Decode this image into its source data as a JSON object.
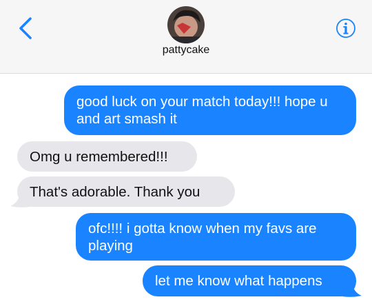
{
  "contact": {
    "name": "pattycake",
    "back_icon": "chevron-left-icon",
    "info_icon": "info-icon",
    "avatar_icon": "profile-photo"
  },
  "colors": {
    "sent_bubble": "#1a83ff",
    "received_bubble": "#e6e6eb",
    "accent": "#1a83ff",
    "header_bg": "#f6f6f7"
  },
  "messages": [
    {
      "direction": "sent",
      "text": "good luck on your match today!!! hope u and art smash it"
    },
    {
      "direction": "received",
      "text": "Omg u remembered!!!"
    },
    {
      "direction": "received",
      "text": "That's adorable. Thank you"
    },
    {
      "direction": "sent",
      "text": "ofc!!!! i gotta know when my favs are playing"
    },
    {
      "direction": "sent",
      "text": "let me know what happens"
    }
  ]
}
